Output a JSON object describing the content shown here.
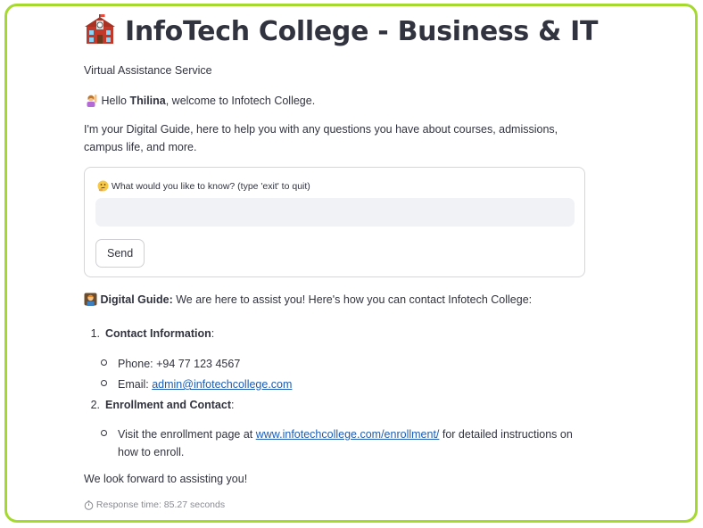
{
  "header": {
    "title": "InfoTech College - Business & IT",
    "title_icon": "school-building-icon",
    "subtitle": "Virtual Assistance Service"
  },
  "greeting": {
    "icon": "person-raising-hand-icon",
    "prefix": "Hello ",
    "name": "Thilina",
    "suffix": ", welcome to Infotech College."
  },
  "intro": "I'm your Digital Guide, here to help you with any questions you have about courses, admissions, campus life, and more.",
  "form": {
    "icon": "thinking-face-icon",
    "label": "What would you like to know? (type 'exit' to quit)",
    "input_value": "",
    "send_label": "Send"
  },
  "reply": {
    "icon": "office-worker-icon",
    "speaker": "Digital Guide:",
    "text": "We are here to assist you! Here's how you can contact Infotech College:",
    "sections": [
      {
        "number": "1.",
        "heading": "Contact Information",
        "suffix": ":",
        "items": [
          {
            "text": "Phone: +94 77 123 4567"
          },
          {
            "prefix": "Email: ",
            "link": "admin@infotechcollege.com"
          }
        ]
      },
      {
        "number": "2.",
        "heading": "Enrollment and Contact",
        "suffix": ":",
        "items": [
          {
            "prefix": "Visit the enrollment page at ",
            "link": "www.infotechcollege.com/enrollment/",
            "suffix": " for detailed instructions on how to enroll."
          }
        ]
      }
    ],
    "closing": "We look forward to assisting you!"
  },
  "footer": {
    "icon": "stopwatch-icon",
    "response_time": "Response time: 85.27 seconds"
  },
  "colors": {
    "frame_border": "#a6d92e",
    "link": "#1d5db3",
    "input_bg": "#f0f2f6",
    "text": "#31333f"
  }
}
